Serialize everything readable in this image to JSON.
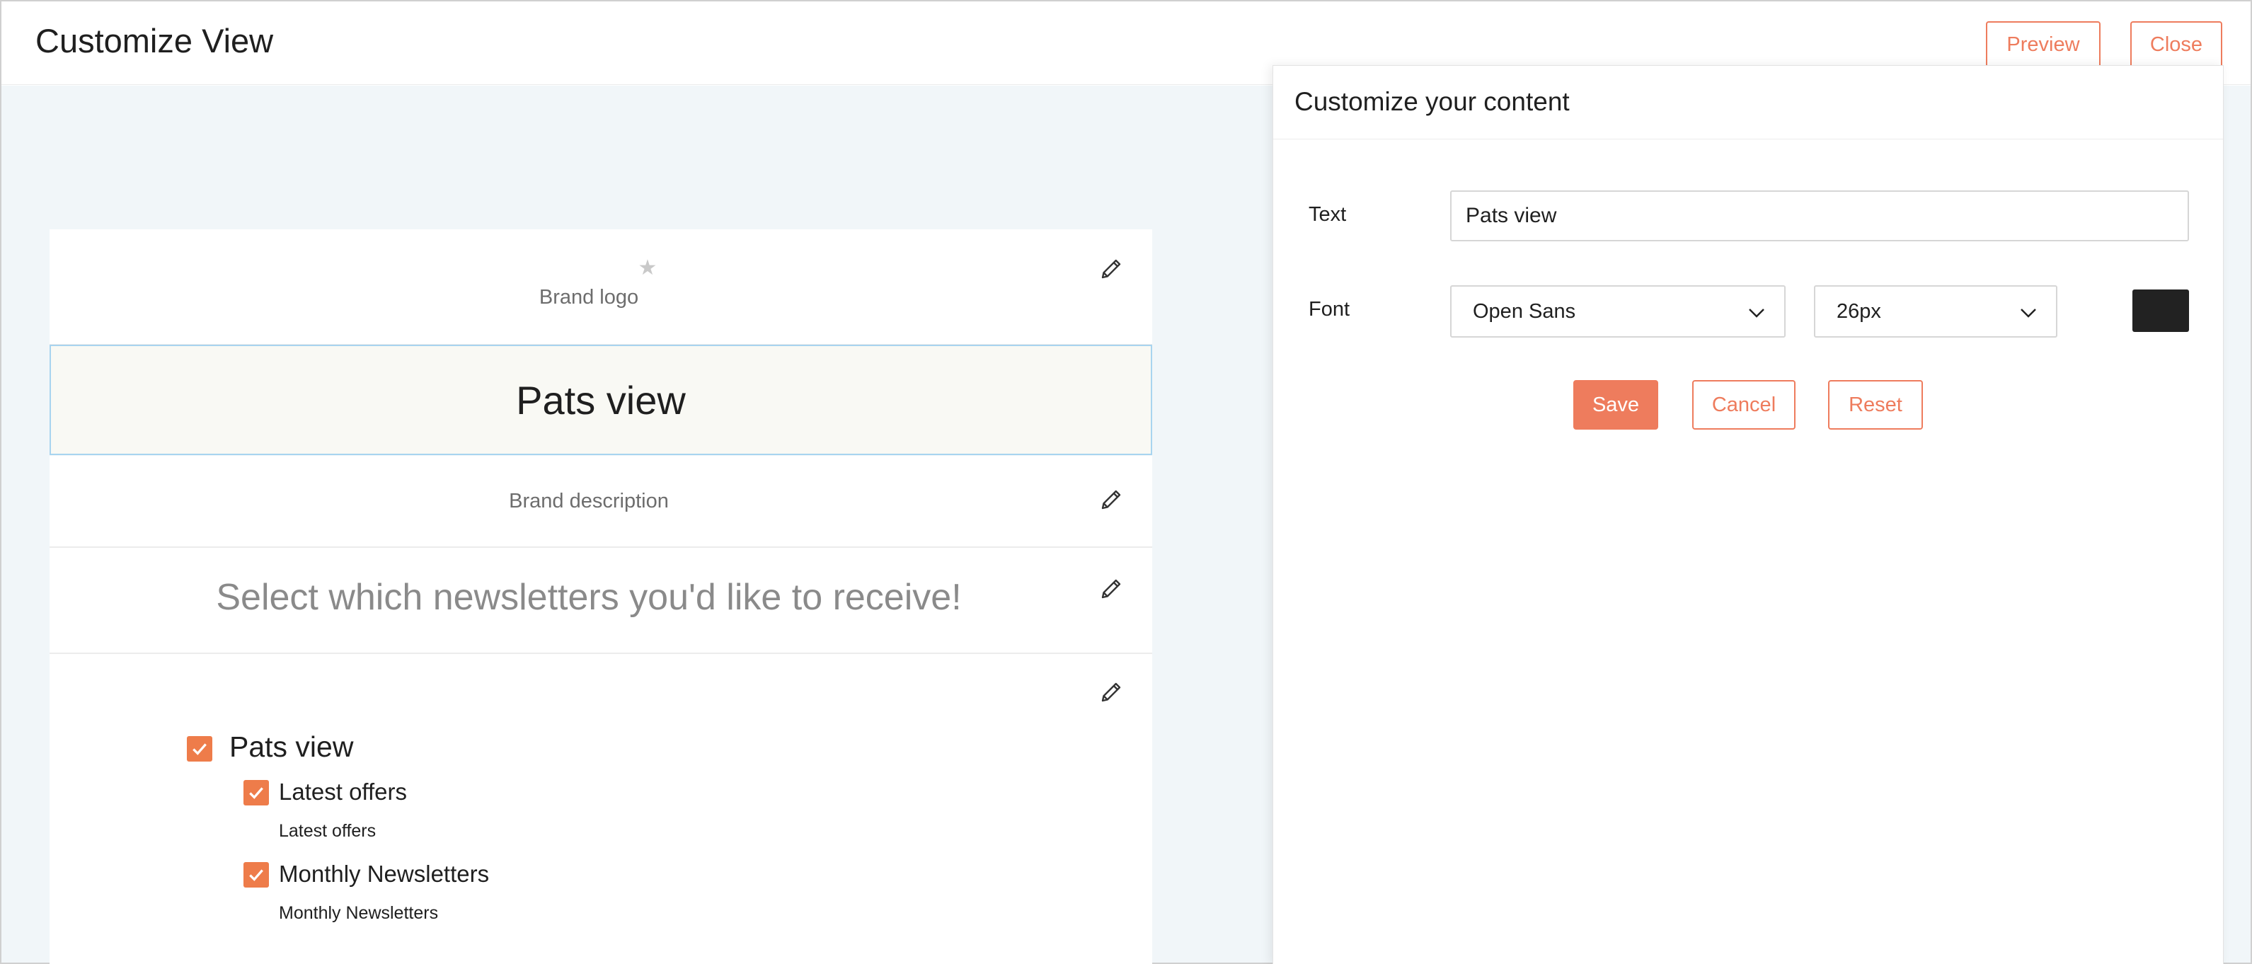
{
  "header": {
    "title": "Customize View",
    "preview_label": "Preview",
    "close_label": "Close"
  },
  "canvas": {
    "brand_logo_label": "Brand logo",
    "title_text": "Pats view",
    "brand_description": "Brand description",
    "heading": "Select which newsletters you'd like to receive!",
    "list": {
      "group_label": "Pats view",
      "group_checked": true,
      "items": [
        {
          "label": "Latest offers",
          "description": "Latest offers",
          "checked": true
        },
        {
          "label": "Monthly Newsletters",
          "description": "Monthly Newsletters",
          "checked": true
        }
      ]
    }
  },
  "panel": {
    "title": "Customize your content",
    "text_label": "Text",
    "text_value": "Pats view",
    "font_label": "Font",
    "font_family": "Open Sans",
    "font_size": "26px",
    "font_color": "#222222",
    "save_label": "Save",
    "cancel_label": "Cancel",
    "reset_label": "Reset"
  },
  "colors": {
    "accent": "#ee7c5d",
    "checkbox": "#ee7c4a",
    "canvas_bg": "#f1f6f9",
    "selected_border": "#a8d4ef"
  }
}
